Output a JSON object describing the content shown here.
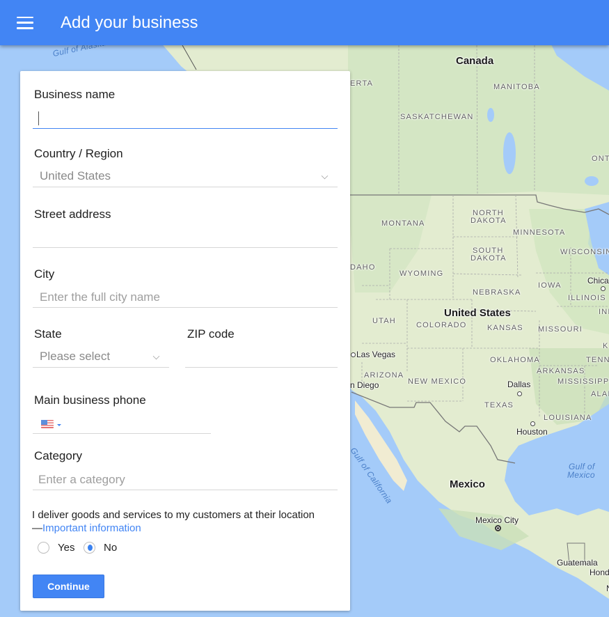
{
  "appbar": {
    "title": "Add your business",
    "menu_icon": "hamburger-menu-icon"
  },
  "form": {
    "business_name": {
      "label": "Business name",
      "value": "",
      "placeholder": ""
    },
    "country": {
      "label": "Country / Region",
      "value": "United States"
    },
    "street": {
      "label": "Street address",
      "value": "",
      "placeholder": ""
    },
    "city": {
      "label": "City",
      "value": "",
      "placeholder": "Enter the full city name"
    },
    "state": {
      "label": "State",
      "value": "Please select"
    },
    "zip": {
      "label": "ZIP code",
      "value": "",
      "placeholder": ""
    },
    "phone": {
      "label": "Main business phone",
      "country_flag": "us-flag-icon",
      "value": ""
    },
    "category": {
      "label": "Category",
      "value": "",
      "placeholder": "Enter a category"
    },
    "delivery": {
      "question": "I deliver goods and services to my customers at their location",
      "link_prefix": "—",
      "link_text": "Important information",
      "options": [
        {
          "label": "Yes",
          "checked": false
        },
        {
          "label": "No",
          "checked": true
        }
      ]
    },
    "continue_label": "Continue"
  },
  "map": {
    "labels": {
      "gulf_alaska": "Gulf of Alaska",
      "canada": "Canada",
      "alberta": "ERTA",
      "manitoba": "MANITOBA",
      "saskatchewan": "SASKATCHEWAN",
      "ontario": "ONT",
      "north_dakota_1": "NORTH",
      "north_dakota_2": "DAKOTA",
      "montana": "MONTANA",
      "minnesota": "MINNESOTA",
      "south_dakota_1": "SOUTH",
      "south_dakota_2": "DAKOTA",
      "wisconsin": "WISCONSIN",
      "idaho": "DAHO",
      "wyoming": "WYOMING",
      "chicago": "Chica",
      "iowa": "IOWA",
      "nebraska": "NEBRASKA",
      "illinois": "ILLINOIS",
      "united_states": "United States",
      "indiana": "INI",
      "utah": "UTAH",
      "colorado": "COLORADO",
      "kansas": "KANSAS",
      "missouri": "MISSOURI",
      "kentucky": "K",
      "las_vegas": "Las Vegas",
      "oklahoma": "OKLAHOMA",
      "tennessee": "TENN",
      "arizona": "ARIZONA",
      "arkansas": "ARKANSAS",
      "san_diego": "n Diego",
      "new_mexico": "NEW MEXICO",
      "dallas": "Dallas",
      "mississippi": "MISSISSIPPI",
      "alabama": "ALAI",
      "texas": "TEXAS",
      "louisiana": "LOUISIANA",
      "houston": "Houston",
      "gulf_california": "Gulf of California",
      "gulf_mexico_1": "Gulf of",
      "gulf_mexico_2": "Mexico",
      "mexico": "Mexico",
      "mexico_city": "Mexico City",
      "guatemala": "Guatemala",
      "honduras": "Hond",
      "nicaragua": "N"
    }
  }
}
